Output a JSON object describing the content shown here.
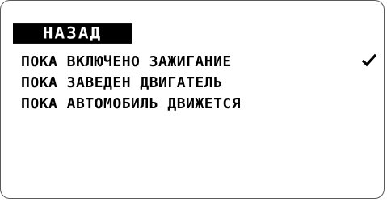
{
  "back_button": {
    "label": "НАЗАД"
  },
  "menu": {
    "items": [
      {
        "label": "ПОКА ВКЛЮЧЕНО ЗАЖИГАНИЕ",
        "checked": true,
        "icon": "check-icon"
      },
      {
        "label": "ПОКА ЗАВЕДЕН ДВИГАТЕЛЬ",
        "checked": false
      },
      {
        "label": "ПОКА АВТОМОБИЛЬ ДВИЖЕТСЯ",
        "checked": false
      }
    ]
  },
  "colors": {
    "background": "#ffffff",
    "text": "#000000",
    "button_bg": "#000000",
    "button_text": "#ffffff",
    "frame": "#5a5a5a"
  }
}
